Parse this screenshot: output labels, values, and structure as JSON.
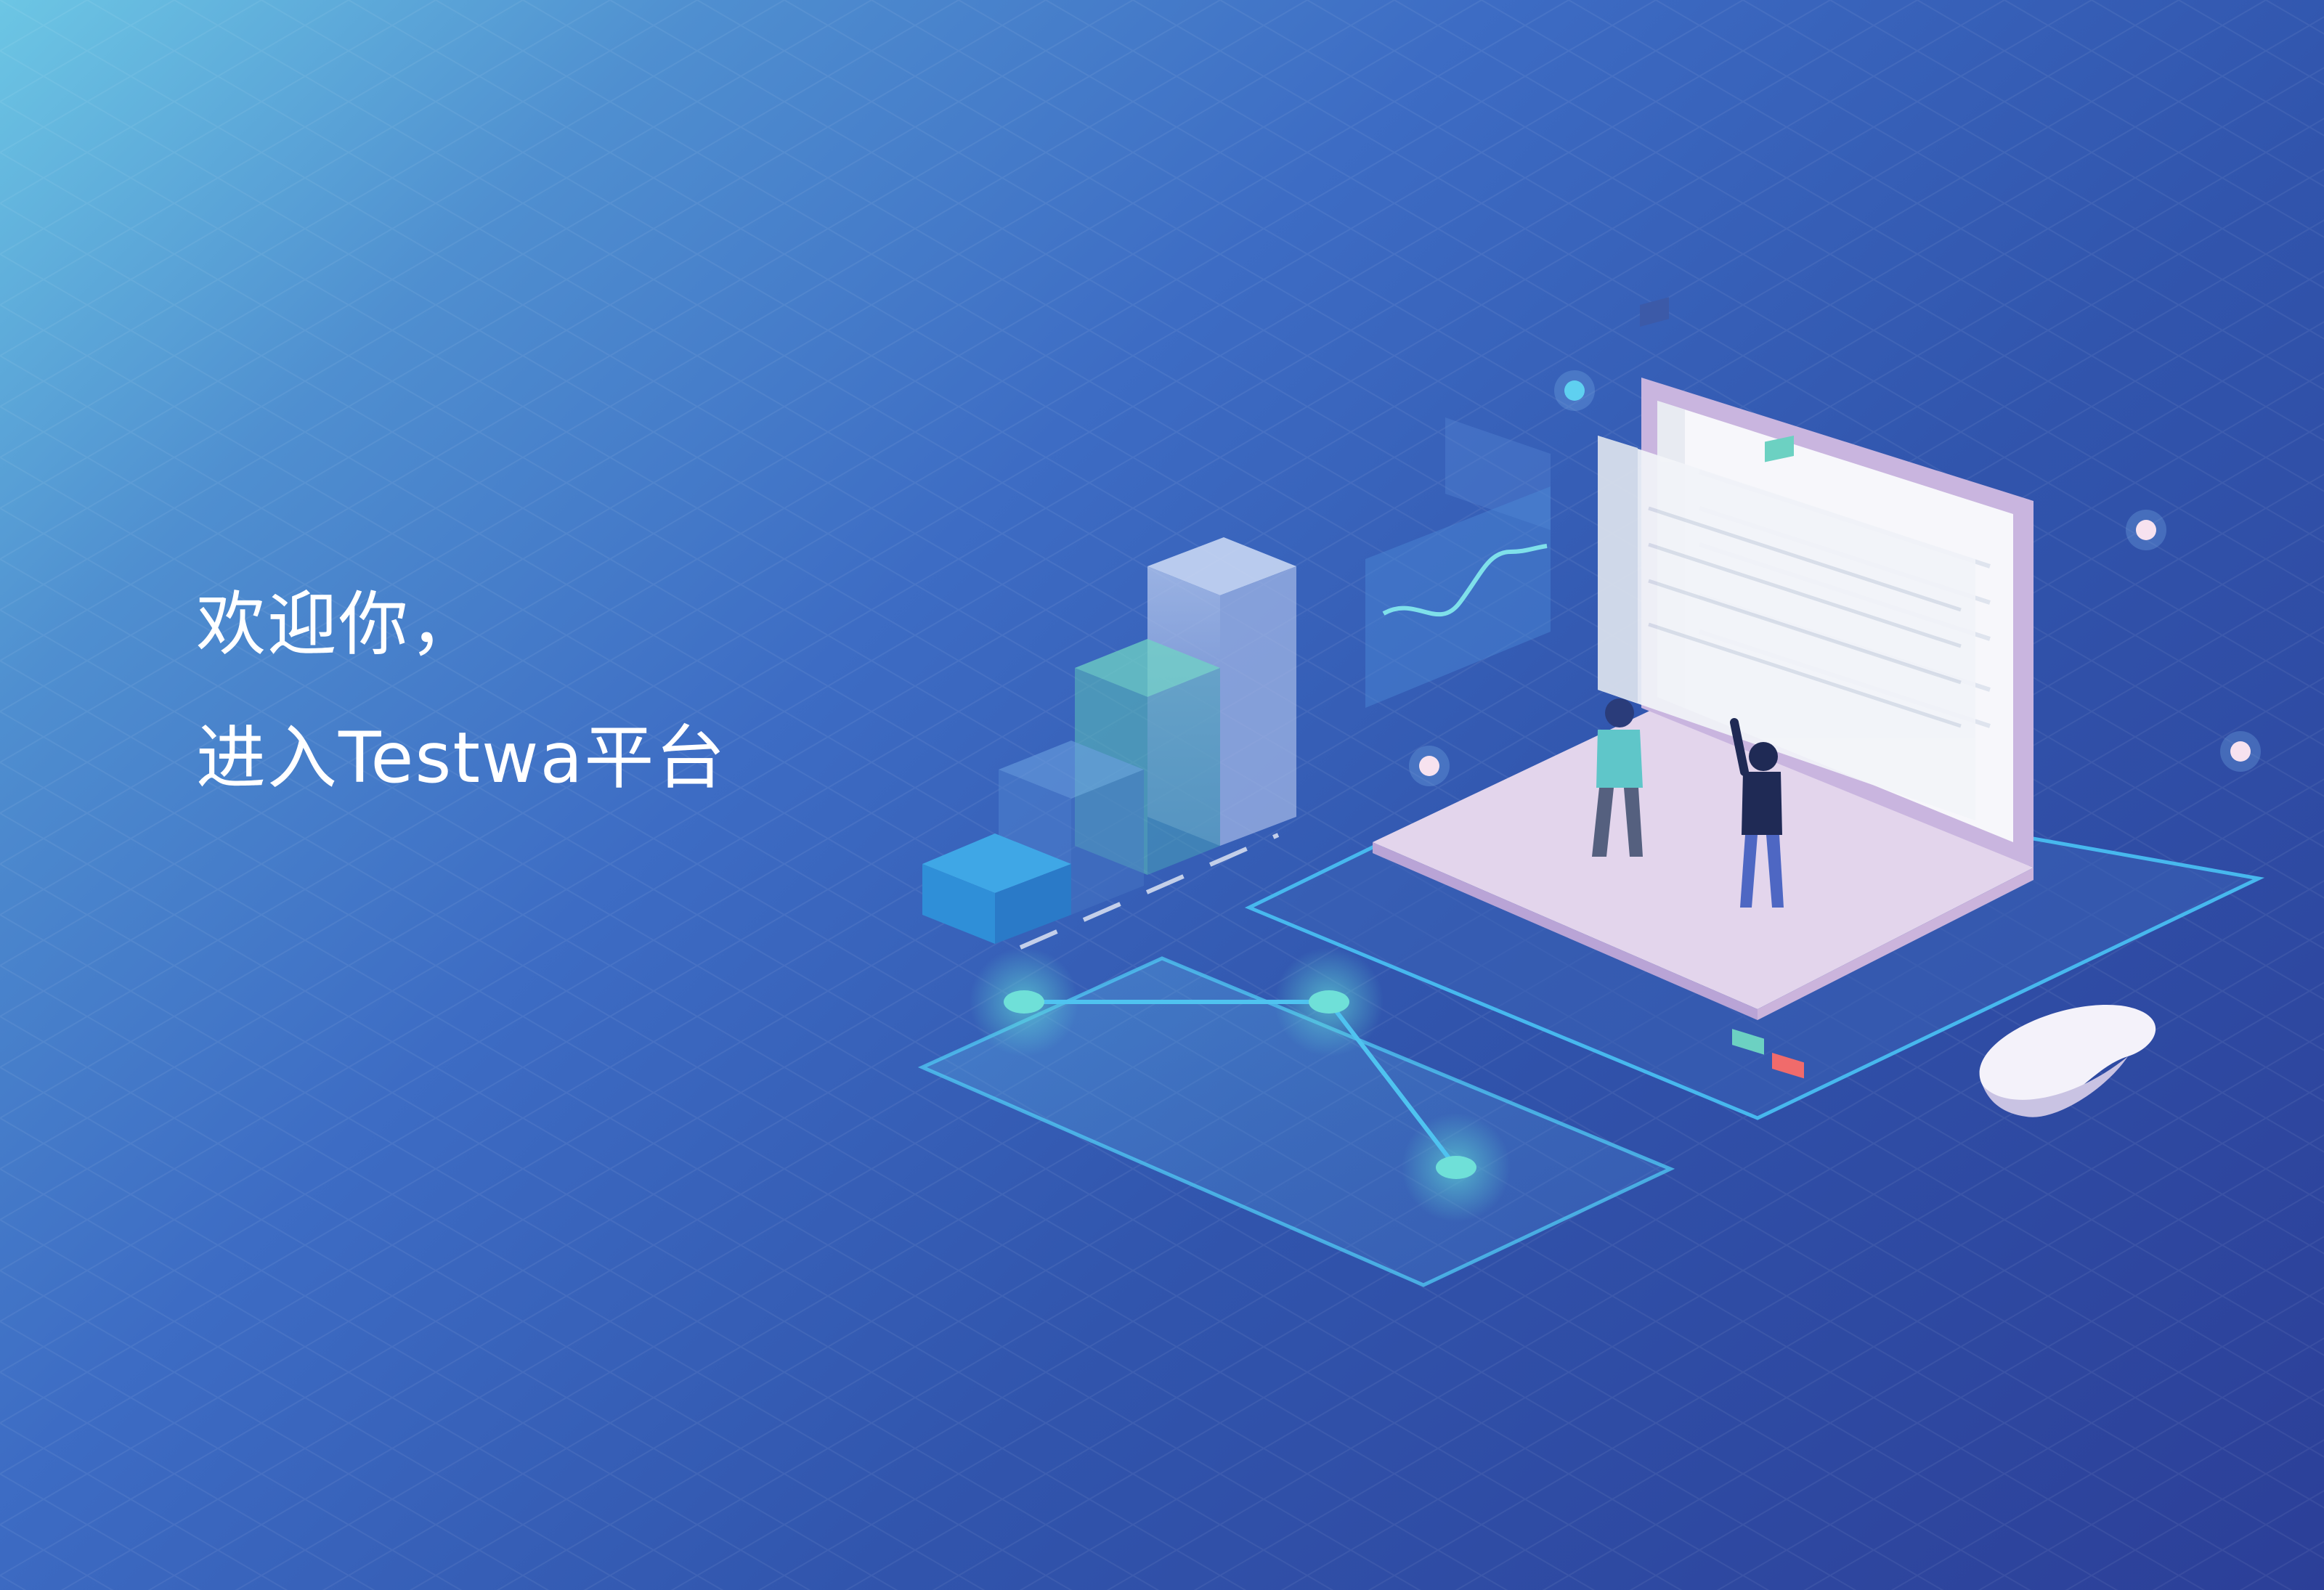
{
  "greeting": {
    "line1": "欢迎你，",
    "line2": "进入Testwa平台"
  },
  "colors": {
    "bg_top_left": "#6cc6e4",
    "bg_mid": "#3d6cc4",
    "bg_bottom_right": "#2c3f98",
    "glow_cyan": "#5fd3d6",
    "laptop_base": "#e2d4ea",
    "laptop_frame": "#c9b5df",
    "text": "#ffffff"
  }
}
